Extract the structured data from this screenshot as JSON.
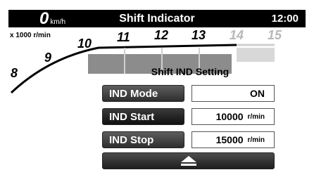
{
  "header": {
    "speed_value": "0",
    "speed_unit": "km/h",
    "title": "Shift Indicator",
    "clock": "12:00"
  },
  "tach": {
    "unit_label": "x 1000 r/min",
    "ticks": [
      "8",
      "9",
      "10",
      "11",
      "12",
      "13",
      "14",
      "15"
    ]
  },
  "setting": {
    "title": "Shift IND Setting",
    "rows": [
      {
        "label": "IND Mode",
        "value": "ON",
        "unit": ""
      },
      {
        "label": "IND Start",
        "value": "10000",
        "unit": "r/min"
      },
      {
        "label": "IND Stop",
        "value": "15000",
        "unit": "r/min"
      }
    ],
    "eject_icon": "eject-icon"
  }
}
